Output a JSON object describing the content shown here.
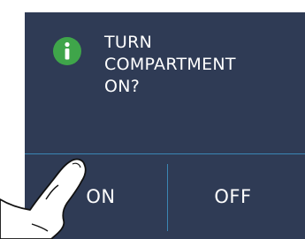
{
  "dialog": {
    "icon": "info-icon",
    "prompt_lines": [
      "TURN",
      "COMPARTMENT",
      "ON?"
    ],
    "on_label": "ON",
    "off_label": "OFF"
  },
  "colors": {
    "panel_background": "#2f3b55",
    "icon_accent": "#3fa54a",
    "divider": "#3b86b4",
    "text": "#ffffff"
  }
}
